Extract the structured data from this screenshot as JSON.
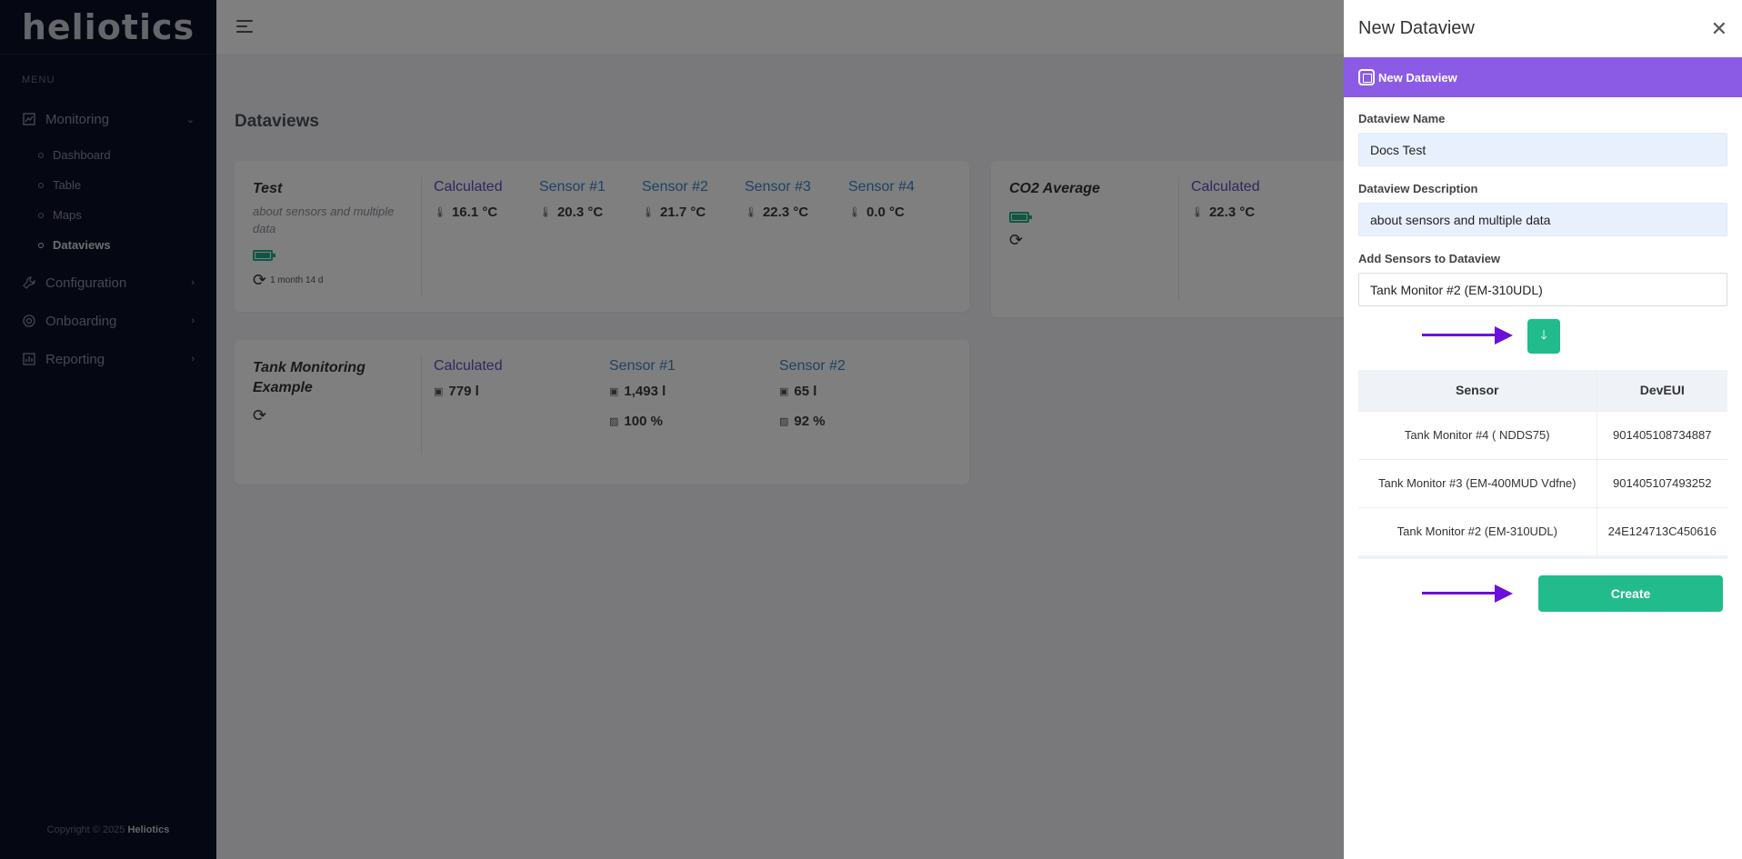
{
  "brand": {
    "logo_text": "heliotics"
  },
  "sidebar": {
    "menu_title": "MENU",
    "items": [
      {
        "label": "Monitoring",
        "icon": "chart-icon",
        "expanded": true
      },
      {
        "label": "Configuration",
        "icon": "wrench-icon"
      },
      {
        "label": "Onboarding",
        "icon": "onboarding-icon"
      },
      {
        "label": "Reporting",
        "icon": "report-icon"
      }
    ],
    "sub_items": [
      {
        "label": "Dashboard"
      },
      {
        "label": "Table"
      },
      {
        "label": "Maps"
      },
      {
        "label": "Dataviews",
        "active": true
      }
    ],
    "copyright_prefix": "Copyright © 2025",
    "copyright_brand": "Heliotics"
  },
  "main": {
    "title": "Dataviews",
    "cards": [
      {
        "name": "Test",
        "description": "about sensors and multiple data",
        "sync_time": "1 month 14 d",
        "columns": [
          {
            "head": "Calculated",
            "value": "16.1 °C"
          },
          {
            "head": "Sensor #1",
            "value": "20.3 °C"
          },
          {
            "head": "Sensor #2",
            "value": "21.7 °C"
          },
          {
            "head": "Sensor #3",
            "value": "22.3 °C"
          },
          {
            "head": "Sensor #4",
            "value": "0.0 °C"
          }
        ]
      },
      {
        "name": "CO2 Average",
        "columns": [
          {
            "head": "Calculated",
            "value": "22.3 °C"
          }
        ]
      },
      {
        "name": "Tank Monitoring Example",
        "columns": [
          {
            "head": "Calculated",
            "value": "779 l"
          },
          {
            "head": "Sensor #1",
            "value": "1,493 l",
            "value2": "100 %"
          },
          {
            "head": "Sensor #2",
            "value": "65 l",
            "value2": "92 %"
          }
        ]
      }
    ]
  },
  "drawer": {
    "title": "New Dataview",
    "banner": "New Dataview",
    "name_label": "Dataview Name",
    "name_value": "Docs Test",
    "desc_label": "Dataview Description",
    "desc_value": "about sensors and multiple data",
    "sensors_label": "Add Sensors to Dataview",
    "sensors_value": "Tank Monitor #2 (EM-310UDL)",
    "table": {
      "headers": [
        "Sensor",
        "DevEUI"
      ],
      "rows": [
        [
          "Tank Monitor #4 ( NDDS75)",
          "901405108734887"
        ],
        [
          "Tank Monitor #3 (EM-400MUD Vdfne)",
          "901405107493252"
        ],
        [
          "Tank Monitor #2 (EM-310UDL)",
          "24E124713C450616"
        ]
      ]
    },
    "create_label": "Create"
  },
  "colors": {
    "sidebar_bg": "#0b0f24",
    "banner": "#8b5be6",
    "accent_green": "#22bb8c",
    "arrow": "#6a0fdc",
    "sensor_link": "#3f82c8",
    "calculated": "#5b4fc4"
  }
}
